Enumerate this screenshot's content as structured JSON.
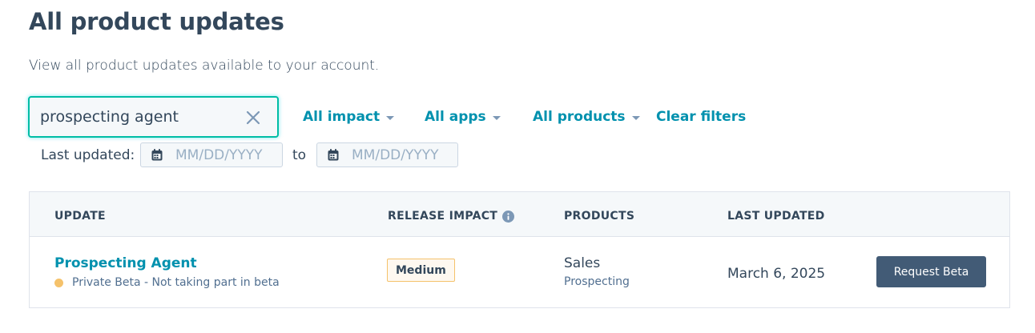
{
  "header": {
    "title": "All product updates",
    "subtitle": "View all product updates available to your account."
  },
  "search": {
    "value": "prospecting agent",
    "clear_icon": "close-icon"
  },
  "filters": {
    "impact": "All impact",
    "apps": "All apps",
    "products": "All products",
    "clear": "Clear filters"
  },
  "date_range": {
    "label": "Last updated:",
    "from_placeholder": "MM/DD/YYYY",
    "separator": "to",
    "to_placeholder": "MM/DD/YYYY",
    "icon": "calendar-icon"
  },
  "table": {
    "columns": {
      "update": "UPDATE",
      "impact": "RELEASE IMPACT",
      "products": "PRODUCTS",
      "last_updated": "LAST UPDATED"
    },
    "rows": [
      {
        "name": "Prospecting Agent",
        "status": "Private Beta - Not taking part in beta",
        "status_color": "#f5c26b",
        "impact": "Medium",
        "product": "Sales",
        "product_sub": "Prospecting",
        "last_updated": "March 6, 2025",
        "action": "Request Beta"
      }
    ]
  },
  "colors": {
    "accent": "#0091ae",
    "focus_border": "#00bda5",
    "primary_button": "#425b76",
    "text": "#33475b"
  }
}
